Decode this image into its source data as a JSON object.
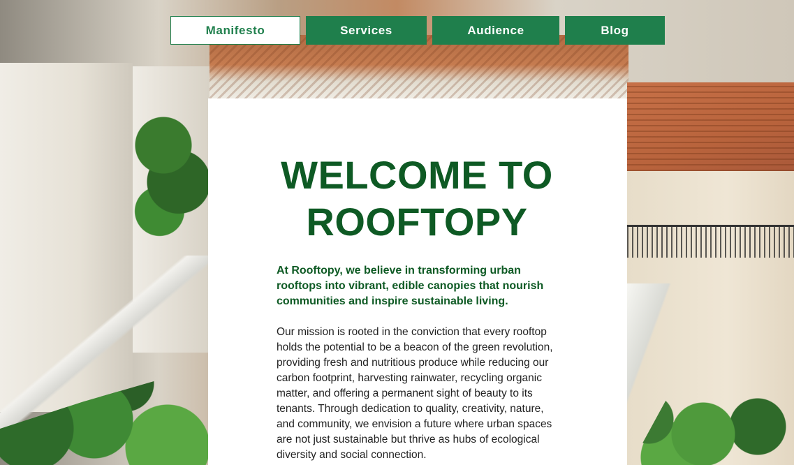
{
  "nav": {
    "items": [
      {
        "label": "Manifesto",
        "active": true
      },
      {
        "label": "Services",
        "active": false
      },
      {
        "label": "Audience",
        "active": false
      },
      {
        "label": "Blog",
        "active": false
      }
    ]
  },
  "hero": {
    "title_line1": "WELCOME TO",
    "title_line2": "ROOFTOPY",
    "lead": "At Rooftopy, we believe in transforming urban rooftops into vibrant, edible canopies that nourish communities and inspire sustainable living.",
    "body": "Our mission is rooted in the conviction that every rooftop holds the potential to be a beacon of the green revolution, providing fresh and nutritious produce while reducing our carbon footprint, harvesting rainwater, recycling organic matter, and offering a permanent sight of beauty to its tenants. Through dedication to quality, creativity, nature, and community, we envision a future where urban spaces are not just sustainable but thrive as hubs of ecological diversity and social connection."
  },
  "colors": {
    "brand_green": "#1f7f4c",
    "heading_green": "#0e5a24",
    "card_bg": "#ffffff"
  }
}
